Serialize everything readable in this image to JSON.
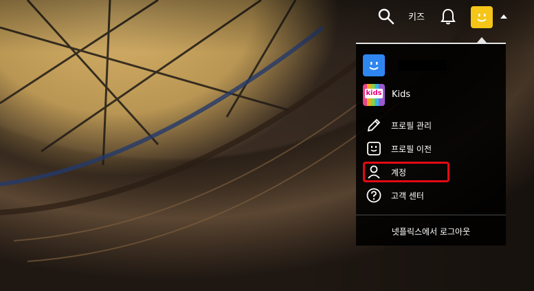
{
  "header": {
    "kids_label": "키즈",
    "icons": {
      "search": "search-icon",
      "notifications": "bell-icon",
      "profile": "smiley-avatar-icon",
      "menu_caret": "caret-up-icon"
    }
  },
  "profile_menu": {
    "profiles": [
      {
        "name": "",
        "avatar": "smiley-avatar-icon",
        "color": "#2f86f0"
      },
      {
        "name": "Kids",
        "avatar": "kids-avatar-icon",
        "badge": "kids"
      }
    ],
    "items": [
      {
        "label": "프로필 관리",
        "icon": "pencil-icon"
      },
      {
        "label": "프로필 이전",
        "icon": "profile-transfer-icon"
      },
      {
        "label": "계정",
        "icon": "person-icon"
      },
      {
        "label": "고객 센터",
        "icon": "help-icon"
      }
    ],
    "signout_label": "넷플릭스에서 로그아웃"
  },
  "colors": {
    "profile_yellow": "#f5c518",
    "profile_blue": "#2f86f0",
    "highlight_red": "#e50914"
  }
}
